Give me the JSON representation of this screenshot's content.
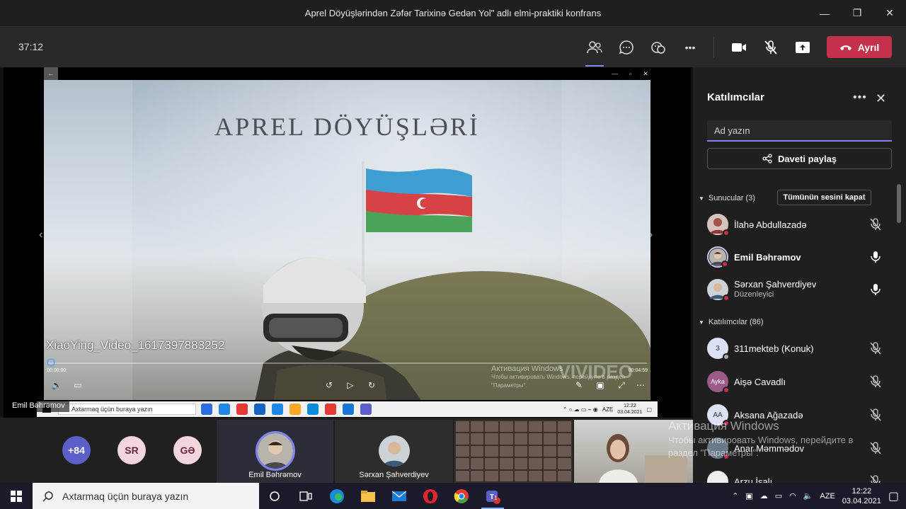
{
  "window": {
    "title": "Aprel Döyüşlərindən Zəfər Tarixinə Gedən Yol\" adlı elmi-praktiki konfrans",
    "minimize": "—",
    "maximize": "❐",
    "close": "✕"
  },
  "toolbar": {
    "timer": "37:12",
    "leave_label": "Ayrıl",
    "more": "•••"
  },
  "shared_screen": {
    "video_title": "APREL DÖYÜŞLƏRİ",
    "video_filename": "XiaoYing_Video_1617397883252",
    "time_start": "00:00:00",
    "time_end": "00:04:59",
    "watermark_line1": "Активация Windows",
    "watermark_line2": "Чтобы активировать Windows, перейдите в раздел",
    "watermark_line3": "\"Параметры\".",
    "watermark_brand": "VIVIDEO",
    "inner_search": "Axtarmaq üçün buraya yazın",
    "inner_lang": "AZE",
    "inner_time": "12:22",
    "inner_date": "03.04.2021",
    "presenter": "Emil Bəhrəmov"
  },
  "panel": {
    "title": "Katılımcılar",
    "search_placeholder": "Ad yazın",
    "invite_label": "Daveti paylaş",
    "presenters_header": "Sunucular (3)",
    "mute_all_label": "Tümünün sesini kapat",
    "attendees_header": "Katılımcılar (86)",
    "presenters": [
      {
        "name": "İlahə Abdullazadə",
        "sub": ""
      },
      {
        "name": "Emil Bəhrəmov",
        "sub": ""
      },
      {
        "name": "Sərxan Şahverdiyev",
        "sub": "Düzenleyici"
      }
    ],
    "attendees": [
      {
        "name": "311mekteb (Konuk)",
        "initials": "3"
      },
      {
        "name": "Aişə Cavadlı",
        "initials": "Ayka"
      },
      {
        "name": "Aksana Ağazadə",
        "initials": "AA"
      },
      {
        "name": "Anar Məmmədov",
        "initials": ""
      },
      {
        "name": "Arzu İsalı",
        "initials": ""
      }
    ]
  },
  "activation": {
    "line1": "Активация Windows",
    "line2": "Чтобы активировать Windows, перейдите в",
    "line3": "раздел \"Параметры\"."
  },
  "strip": {
    "overflow_count": "+84",
    "bubble2": "SR",
    "bubble3": "GƏ",
    "tile1_name": "Emil Bəhrəmov",
    "tile2_name": "Sərxan Şahverdiyev"
  },
  "taskbar": {
    "search_placeholder": "Axtarmaq üçün buraya yazın",
    "lang": "AZE",
    "time": "12:22",
    "date": "03.04.2021",
    "teams_badge": "1"
  }
}
